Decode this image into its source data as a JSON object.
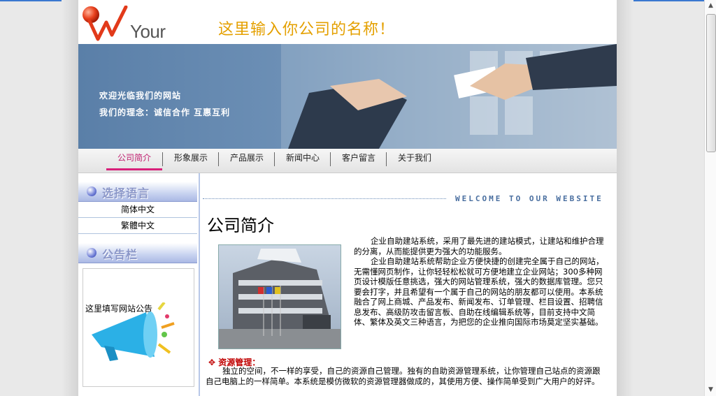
{
  "header": {
    "logo_text": "Your Logo",
    "company_name": "这里输入你公司的名称！"
  },
  "banner": {
    "line1": "欢迎光临我们的网站",
    "line2": "我们的理念：诚信合作 互惠互利"
  },
  "nav": {
    "items": [
      {
        "label": "公司简介",
        "active": true
      },
      {
        "label": "形象展示"
      },
      {
        "label": "产品展示"
      },
      {
        "label": "新闻中心"
      },
      {
        "label": "客户留言"
      },
      {
        "label": "关于我们"
      }
    ]
  },
  "sidebar": {
    "language_title": "选择语言",
    "languages": [
      "简体中文",
      "繁體中文"
    ],
    "notice_title": "公告栏",
    "notice_text": "这里填写网站公告"
  },
  "main": {
    "welcome_en": "WELCOME TO OUR WEBSITE",
    "title": "公司简介",
    "intro_p1": "企业自助建站系统，采用了最先进的建站模式，让建站和维护合理的分离，从而能提供更为强大的功能服务。",
    "intro_p2": "企业自助建站系统帮助企业方便快捷的创建完全属于自己的网站，无需懂网页制作，让你轻轻松松就可方便地建立企业网站；300多种网页设计模版任意挑选，强大的网站管理系统，强大的数据库管理。您只要会打字，并且希望有一个属于自己的网站的朋友都可以使用。本系统融合了网上商城、产品发布、新闻发布、订单管理、栏目设置、招聘信息发布、高级防攻击留言板、自助在线编辑系统等，目前支持中文简体、繁体及英文三种语言，为把您的企业推向国际市场莫定坚实基础。",
    "resource_title": "资源管理：",
    "resource_text": "独立的空间，不一样的享受，自己的资源自己管理。独有的自助资源管理系统，让你管理自己站点的资源跟自己电脑上的一样简单。本系统是模仿微软的资源管理器做成的，其使用方便、操作简单受到广大用户的好评。"
  },
  "colors": {
    "accent_orange": "#e4a000",
    "nav_active": "#d8207a",
    "resource_red": "#c00000"
  }
}
